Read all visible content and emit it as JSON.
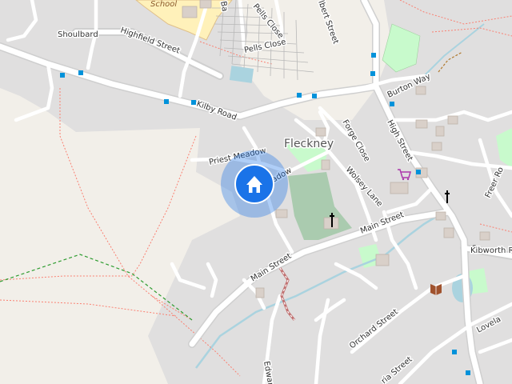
{
  "map": {
    "place_name": "Fleckney",
    "school_label": "School",
    "streets": {
      "shoulbard": "Shoulbard",
      "highfield": "Highfield Street",
      "kilby": "Kilby Road",
      "priest_meadow": "Priest Meadow",
      "meadow_partial": "adow",
      "pells_close_top": "Pells Close",
      "pells_close": "Pells Close",
      "ba": "Ba",
      "albert": "lbert Street",
      "burton_way": "Burton Way",
      "forge_close": "Forge Close",
      "high_street": "High Street",
      "wolsey_lane": "Wolsey Lane",
      "main_street_east": "Main Street",
      "main_street_west": "Main Street",
      "kibworth": "Kibworth Ro",
      "freer": "Freer Ro",
      "orchard": "Orchard Street",
      "lovelace": "Lovela",
      "edwards": "Edwar",
      "victoria": "ria Street"
    },
    "marker": {
      "type": "home-location",
      "color": "#1a73e8"
    },
    "colors": {
      "background": "#f2efe9",
      "residential": "#e0dfdf",
      "road": "#ffffff",
      "park": "#c8facc",
      "cemetery": "#aacbaf",
      "water": "#aad3df",
      "school": "#fff1ba",
      "bus_stop": "#0092da",
      "path_red": "#fa8072",
      "path_green": "#2e9c30"
    }
  }
}
